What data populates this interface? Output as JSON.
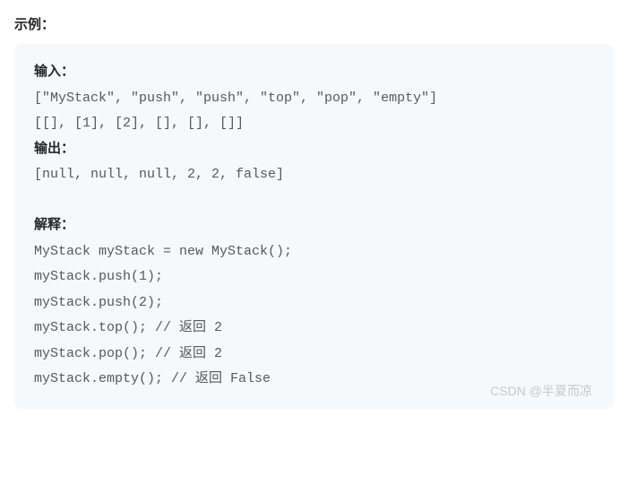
{
  "title": "示例：",
  "input_label": "输入：",
  "input_line1": "[\"MyStack\", \"push\", \"push\", \"top\", \"pop\", \"empty\"]",
  "input_line2": "[[], [1], [2], [], [], []]",
  "output_label": "输出：",
  "output_line": "[null, null, null, 2, 2, false]",
  "explain_label": "解释：",
  "explain_lines": [
    "MyStack myStack = new MyStack();",
    "myStack.push(1);",
    "myStack.push(2);",
    "myStack.top(); // 返回 2",
    "myStack.pop(); // 返回 2",
    "myStack.empty(); // 返回 False"
  ],
  "watermark": "CSDN @半夏而凉"
}
